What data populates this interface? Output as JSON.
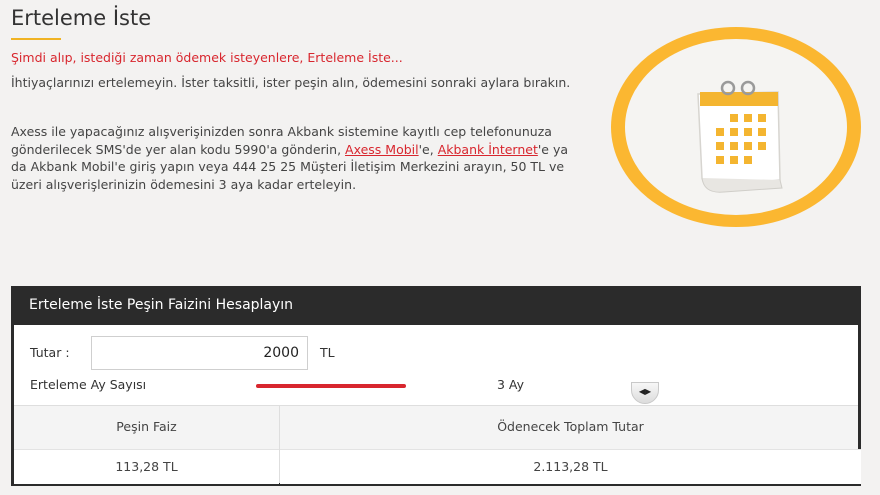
{
  "page": {
    "title": "Erteleme İste",
    "intro": "Şimdi alıp, istediği zaman ödemek isteyenlere, Erteleme İste...",
    "para1": "İhtiyaçlarınızı ertelemeyin. İster taksitli, ister peşin alın, ödemesini sonraki aylara bırakın.",
    "para2_a": "Axess ile yapacağınız alışverişinizden sonra Akbank sistemine kayıtlı cep telefonunuza gönderilecek SMS'de yer alan kodu 5990'a gönderin, ",
    "link_axess_mobil": "Axess Mobil",
    "para2_b": "'e, ",
    "link_akbank_internet": "Akbank İnternet",
    "para2_c": "'e ya da Akbank Mobil'e giriş yapın veya 444 25 25 Müşteri İletişim Merkezini arayın, 50 TL ve üzeri alışverişlerinizin ödemesini 3 aya kadar erteleyin."
  },
  "hero": {
    "icon": "calendar-icon",
    "ring_color": "#fbb731",
    "accent_color": "#f0b323"
  },
  "calculator": {
    "title": "Erteleme İste Peşin Faizini Hesaplayın",
    "amount_label": "Tutar :",
    "amount_value": "2000",
    "amount_unit": "TL",
    "term_label": "Erteleme Ay Sayısı",
    "slider_level": 1.0,
    "slider_handle_glyph": "◀▶",
    "term_value": "3 Ay",
    "slider_color": "#d8262e",
    "result_headers": {
      "interest": "Peşin Faiz",
      "total": "Ödenecek Toplam Tutar"
    },
    "results": {
      "interest": "113,28 TL",
      "total": "2.113,28 TL"
    }
  }
}
